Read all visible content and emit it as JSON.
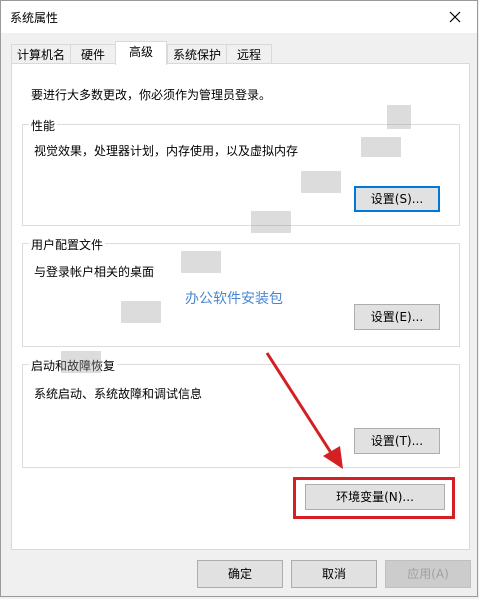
{
  "window": {
    "title": "系统属性"
  },
  "tabs": [
    {
      "label": "计算机名"
    },
    {
      "label": "硬件"
    },
    {
      "label": "高级"
    },
    {
      "label": "系统保护"
    },
    {
      "label": "远程"
    }
  ],
  "panel": {
    "admin_note": "要进行大多数更改，你必须作为管理员登录。",
    "performance": {
      "title": "性能",
      "desc": "视觉效果，处理器计划，内存使用，以及虚拟内存",
      "button": "设置(S)..."
    },
    "user_profiles": {
      "title": "用户配置文件",
      "desc": "与登录帐户相关的桌面",
      "button": "设置(E)..."
    },
    "startup_recovery": {
      "title": "启动和故障恢复",
      "desc": "系统启动、系统故障和调试信息",
      "button": "设置(T)..."
    },
    "env_button": "环境变量(N)..."
  },
  "footer": {
    "ok": "确定",
    "cancel": "取消",
    "apply": "应用(A)"
  },
  "watermark": "办公软件安装包",
  "colors": {
    "highlight": "#d41f23",
    "arrow": "#d41f23",
    "focus": "#0078d7"
  }
}
